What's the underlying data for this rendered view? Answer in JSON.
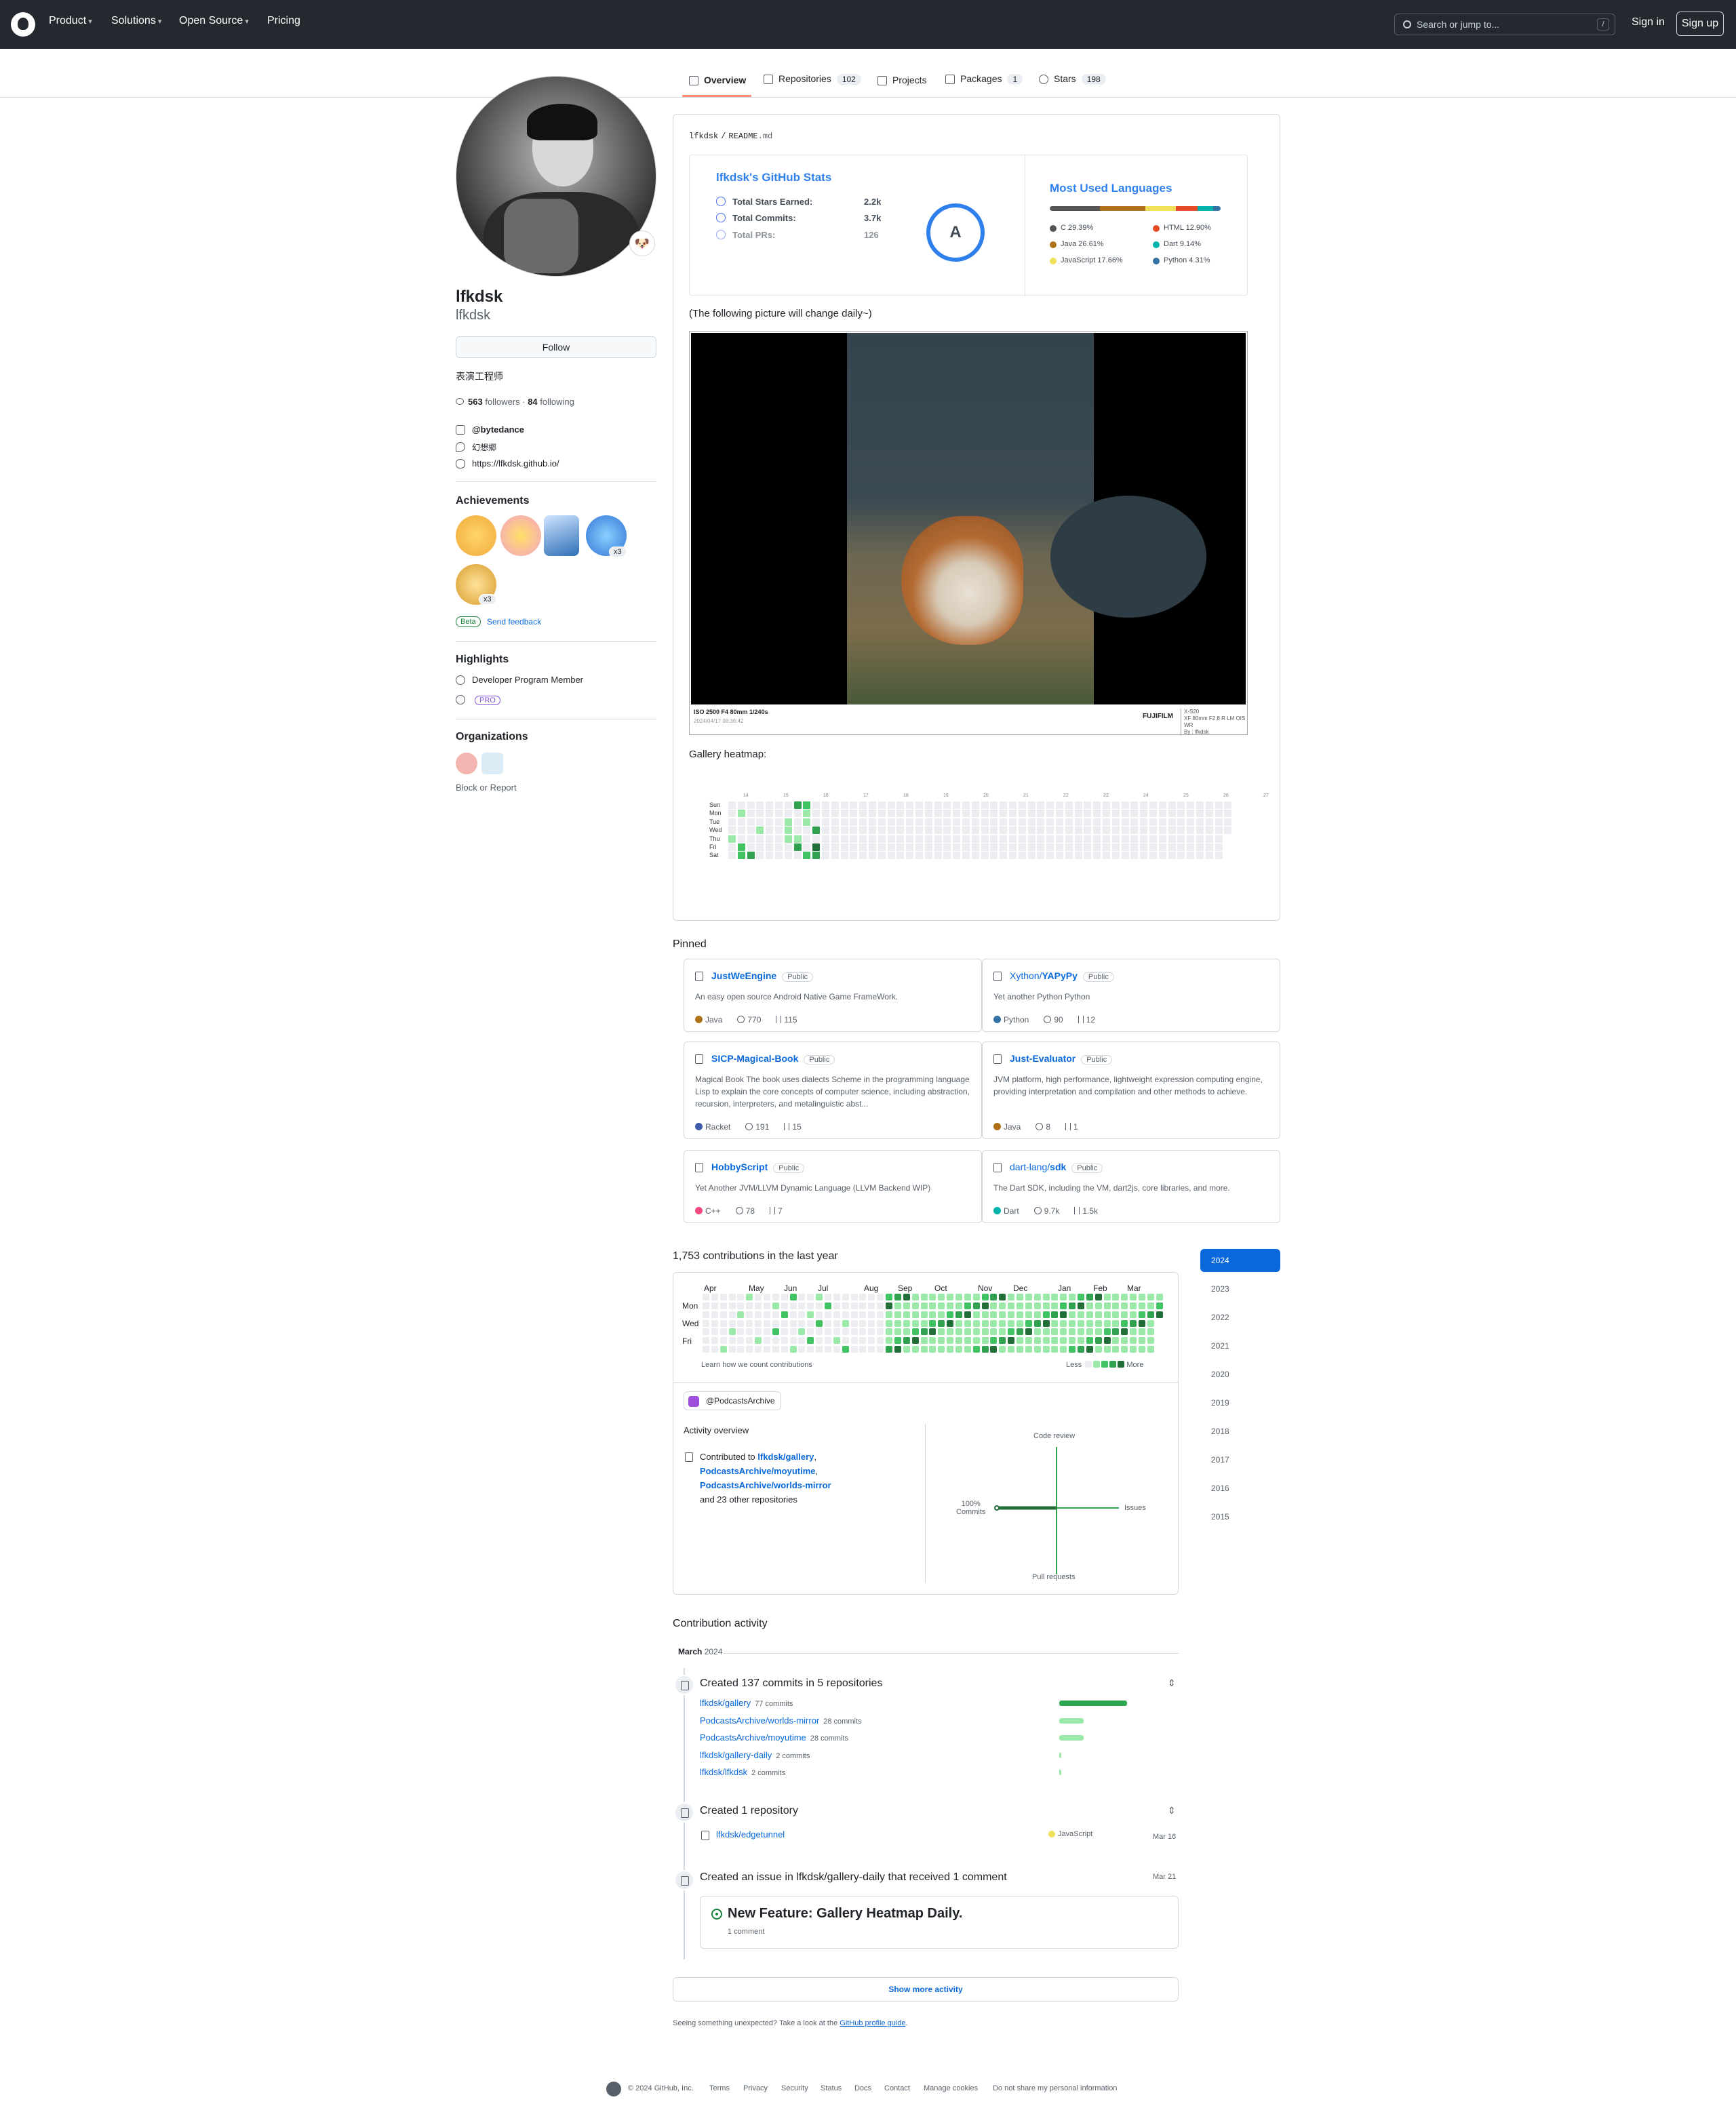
{
  "header": {
    "nav": [
      "Product",
      "Solutions",
      "Open Source",
      "Pricing"
    ],
    "search_placeholder": "Search or jump to...",
    "search_key": "/",
    "sign_in": "Sign in",
    "sign_up": "Sign up"
  },
  "tabs": [
    {
      "label": "Overview",
      "count": "",
      "icon": "book-icon"
    },
    {
      "label": "Repositories",
      "count": "102",
      "icon": "repo-icon"
    },
    {
      "label": "Projects",
      "count": "",
      "icon": "table-icon"
    },
    {
      "label": "Packages",
      "count": "1",
      "icon": "package-icon"
    },
    {
      "label": "Stars",
      "count": "198",
      "icon": "star-icon"
    }
  ],
  "profile": {
    "name": "lfkdsk",
    "login": "lfkdsk",
    "follow": "Follow",
    "bio": "表演工程师",
    "followers": "563",
    "followers_label": "followers",
    "following": "84",
    "following_label": "following",
    "company": "@bytedance",
    "location": "幻想郷",
    "website": "https://lfkdsk.github.io/",
    "status_emoji": "🐶"
  },
  "achievements": {
    "title": "Achievements",
    "badges": [
      {
        "name": "Quickdraw",
        "color": "#f0a93b",
        "count": ""
      },
      {
        "name": "YOLO",
        "color": "#f5a3c7",
        "count": ""
      },
      {
        "name": "Starstruck",
        "color": "#2d6fb7",
        "count": ""
      },
      {
        "name": "Pull Shark",
        "color": "#3276d6",
        "count": "x3"
      },
      {
        "name": "Pair Extraordinaire",
        "color": "#d89b2b",
        "count": "x3"
      }
    ],
    "beta": "Beta",
    "feedback": "Send feedback"
  },
  "highlights": {
    "title": "Highlights",
    "program": "Developer Program Member",
    "pro": "PRO"
  },
  "organizations": {
    "title": "Organizations",
    "block": "Block or Report"
  },
  "readme": {
    "path_user": "lfkdsk",
    "path_sep": "/",
    "path_file": "README",
    "path_ext": ".md",
    "stats_title": "lfkdsk's GitHub Stats",
    "stats": [
      {
        "label": "Total Stars Earned:",
        "value": "2.2k"
      },
      {
        "label": "Total Commits:",
        "value": "3.7k"
      },
      {
        "label": "Total PRs:",
        "value": "126"
      }
    ],
    "grade": "A",
    "langs_title": "Most Used Languages",
    "langs": [
      {
        "name": "C 29.39%",
        "color": "#555555",
        "pct": 29.39
      },
      {
        "name": "Java 26.61%",
        "color": "#b07219",
        "pct": 26.61
      },
      {
        "name": "JavaScript 17.66%",
        "color": "#f1e05a",
        "pct": 17.66
      },
      {
        "name": "HTML 12.90%",
        "color": "#e34c26",
        "pct": 12.9
      },
      {
        "name": "Dart 9.14%",
        "color": "#00b4ab",
        "pct": 9.14
      },
      {
        "name": "Python 4.31%",
        "color": "#3572A5",
        "pct": 4.31
      }
    ],
    "picture_note": "(The following picture will change daily~)",
    "photo": {
      "exif": "ISO 2500 F4 80mm 1/240s",
      "datetime": "2024/04/17 08:36:42",
      "brand": "FUJIFILM",
      "model": "X-S20",
      "lens": "XF 80mm F2.8 R LM OIS WR",
      "author": "By : lfkdsk"
    },
    "gallery_label": "Gallery heatmap:",
    "gallery_days": [
      "Sun",
      "Mon",
      "Tue",
      "Wed",
      "Thu",
      "Fri",
      "Sat"
    ],
    "gallery_weeks": [
      "14",
      "15",
      "16",
      "17",
      "18",
      "19",
      "20",
      "21",
      "22",
      "23",
      "24",
      "25",
      "26",
      "27"
    ]
  },
  "pinned": {
    "title": "Pinned",
    "items": [
      {
        "owner": "",
        "name": "JustWeEngine",
        "vis": "Public",
        "desc": "An easy open source Android Native Game FrameWork.",
        "lang": "Java",
        "lang_color": "#b07219",
        "stars": "770",
        "forks": "115"
      },
      {
        "owner": "Xython/",
        "name": "YAPyPy",
        "vis": "Public",
        "desc": "Yet another Python Python",
        "lang": "Python",
        "lang_color": "#3572A5",
        "stars": "90",
        "forks": "12"
      },
      {
        "owner": "",
        "name": "SICP-Magical-Book",
        "vis": "Public",
        "desc": "Magical Book The book uses dialects Scheme in the programming language Lisp to explain the core concepts of computer science, including abstraction, recursion, interpreters, and metalinguistic abst...",
        "lang": "Racket",
        "lang_color": "#3c5caa",
        "stars": "191",
        "forks": "15"
      },
      {
        "owner": "",
        "name": "Just-Evaluator",
        "vis": "Public",
        "desc": "JVM platform, high performance, lightweight expression computing engine, providing interpretation and compilation and other methods to achieve.",
        "lang": "Java",
        "lang_color": "#b07219",
        "stars": "8",
        "forks": "1"
      },
      {
        "owner": "",
        "name": "HobbyScript",
        "vis": "Public",
        "desc": "Yet Another JVM/LLVM Dynamic Language (LLVM Backend WIP)",
        "lang": "C++",
        "lang_color": "#f34b7d",
        "stars": "78",
        "forks": "7"
      },
      {
        "owner": "dart-lang/",
        "name": "sdk",
        "vis": "Public",
        "desc": "The Dart SDK, including the VM, dart2js, core libraries, and more.",
        "lang": "Dart",
        "lang_color": "#00b4ab",
        "stars": "9.7k",
        "forks": "1.5k"
      }
    ]
  },
  "contributions": {
    "heading": "1,753 contributions in the last year",
    "months": [
      "Apr",
      "May",
      "Jun",
      "Jul",
      "Aug",
      "Sep",
      "Oct",
      "Nov",
      "Dec",
      "Jan",
      "Feb",
      "Mar"
    ],
    "days": [
      "Mon",
      "Wed",
      "Fri"
    ],
    "learn": "Learn how we count contributions",
    "less": "Less",
    "more": "More",
    "level_colors": [
      "#ebedf0",
      "#9be9a8",
      "#40c463",
      "#30a14e",
      "#216e39"
    ],
    "org_chip": "@PodcastsArchive",
    "activity_title": "Activity overview",
    "contributed_to": "Contributed to",
    "repos": [
      "lfkdsk/gallery",
      "PodcastsArchive/moyutime",
      "PodcastsArchive/worlds-mirror"
    ],
    "others": "and 23 other repositories",
    "axis": {
      "code_review": "Code review",
      "issues": "Issues",
      "pull_requests": "Pull requests",
      "commits_pct": "100%",
      "commits": "Commits"
    },
    "years": [
      "2024",
      "2023",
      "2022",
      "2021",
      "2020",
      "2019",
      "2018",
      "2017",
      "2016",
      "2015"
    ]
  },
  "activity": {
    "title": "Contribution activity",
    "month": "March",
    "year": "2024",
    "commits_title": "Created 137 commits in 5 repositories",
    "commit_repos": [
      {
        "name": "lfkdsk/gallery",
        "count": "77 commits",
        "n": 77
      },
      {
        "name": "PodcastsArchive/worlds-mirror",
        "count": "28 commits",
        "n": 28
      },
      {
        "name": "PodcastsArchive/moyutime",
        "count": "28 commits",
        "n": 28
      },
      {
        "name": "lfkdsk/gallery-daily",
        "count": "2 commits",
        "n": 2
      },
      {
        "name": "lfkdsk/lfkdsk",
        "count": "2 commits",
        "n": 2
      }
    ],
    "repo_title": "Created 1 repository",
    "new_repo": "lfkdsk/edgetunnel",
    "new_repo_lang": "JavaScript",
    "new_repo_date": "Mar 16",
    "issue_title": "Created an issue in lfkdsk/gallery-daily that received 1 comment",
    "issue_date": "Mar 21",
    "issue_name": "New Feature: Gallery Heatmap Daily.",
    "issue_comments": "1 comment",
    "show_more": "Show more activity",
    "guide_prefix": "Seeing something unexpected? Take a look at the",
    "guide_link": "GitHub profile guide",
    "guide_suffix": "."
  },
  "footer": [
    "© 2024 GitHub, Inc.",
    "Terms",
    "Privacy",
    "Security",
    "Status",
    "Docs",
    "Contact",
    "Manage cookies",
    "Do not share my personal information"
  ]
}
